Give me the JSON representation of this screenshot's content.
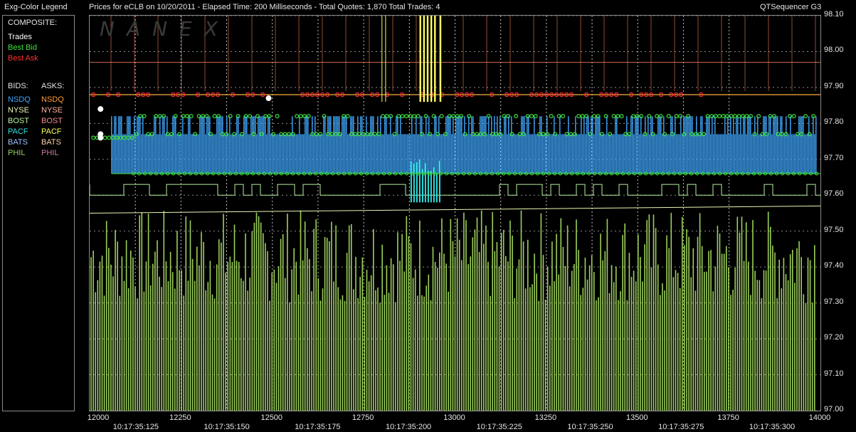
{
  "header": {
    "legend_title": "Exg-Color Legend",
    "title": "Prices for  eCLB  on  10/20/2011  -  Elapsed Time: 200 Milliseconds  -  Total Quotes: 1,870  Total Trades: 4",
    "app_name": "QTSequencer G3"
  },
  "watermark": "NANEX",
  "legend": {
    "composite_label": "COMPOSITE:",
    "trades": {
      "label": "Trades",
      "color": "#ffffff"
    },
    "best_bid": {
      "label": "Best Bid",
      "color": "#3ee03e"
    },
    "best_ask": {
      "label": "Best Ask",
      "color": "#ff3030"
    },
    "bids_label": "BIDS:",
    "asks_label": "ASKS:",
    "bids": [
      {
        "label": "NSDQ",
        "color": "#3fa9ff"
      },
      {
        "label": "NYSE",
        "color": "#e8f7b0"
      },
      {
        "label": "BOST",
        "color": "#b6f0a0"
      },
      {
        "label": "PACF",
        "color": "#2fe0e0"
      },
      {
        "label": "BATS",
        "color": "#9fc4ff"
      },
      {
        "label": "PHIL",
        "color": "#9ccf5a"
      }
    ],
    "asks": [
      {
        "label": "NSDQ",
        "color": "#ff9a3c"
      },
      {
        "label": "NYSE",
        "color": "#ffb0a0"
      },
      {
        "label": "BOST",
        "color": "#f08a8a"
      },
      {
        "label": "PACF",
        "color": "#ffff60"
      },
      {
        "label": "BATS",
        "color": "#ffd0a8"
      },
      {
        "label": "PHIL",
        "color": "#c87a9a"
      }
    ]
  },
  "chart_data": {
    "type": "line",
    "xlim": [
      12000,
      14000
    ],
    "ylim": [
      97.0,
      98.1
    ],
    "x_ticks": [
      "12000",
      "12250",
      "12500",
      "12750",
      "13000",
      "13250",
      "13500",
      "13750",
      "14000"
    ],
    "time_labels": [
      "10:17:35:125",
      "10:17:35:150",
      "10:17:35:175",
      "10:17:35:200",
      "10:17:35:225",
      "10:17:35:250",
      "10:17:35:275",
      "10:17:35:300"
    ],
    "y_ticks": [
      "98.10",
      "98.00",
      "97.90",
      "97.80",
      "97.70",
      "97.60",
      "97.50",
      "97.40",
      "97.30",
      "97.20",
      "97.10",
      "97.00"
    ],
    "grid": true,
    "series": [
      {
        "name": "Best Ask",
        "color": "#ff3030",
        "level": 97.88
      },
      {
        "name": "Best Bid",
        "color": "#3ee03e",
        "level": 97.76,
        "high": 97.82,
        "low": 97.66
      },
      {
        "name": "NSDQ",
        "color": "#3fa9ff",
        "range": [
          97.66,
          97.82
        ]
      },
      {
        "name": "PHIL",
        "color": "#9ccf5a",
        "range": [
          97.0,
          97.56
        ]
      },
      {
        "name": "PACF",
        "color": "#ffff60",
        "range": [
          97.86,
          98.1
        ]
      },
      {
        "name": "Trades",
        "color": "#ffffff",
        "points": [
          [
            12020,
            97.84
          ],
          [
            12020,
            97.77
          ],
          [
            12020,
            97.76
          ],
          [
            12480,
            97.87
          ]
        ]
      }
    ]
  }
}
